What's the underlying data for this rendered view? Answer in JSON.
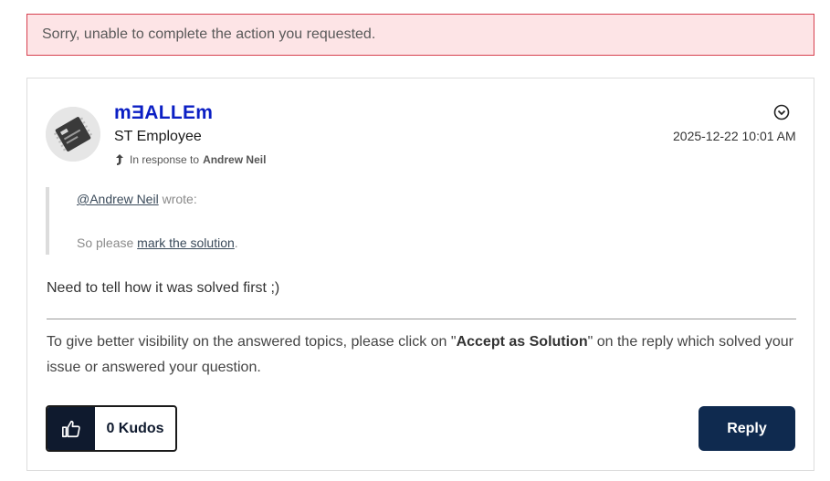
{
  "alert": {
    "message": "Sorry, unable to complete the action you requested."
  },
  "post": {
    "author": "mƎALLEm",
    "rank": "ST Employee",
    "in_response_prefix": "In response to",
    "in_response_to": "Andrew Neil",
    "timestamp": "2025-12-22 10:01 AM",
    "quote": {
      "mention": "@Andrew Neil",
      "wrote": "wrote:",
      "line2_prefix": "So please",
      "link": "mark the solution",
      "line2_suffix": "."
    },
    "body": "Need to tell how it was solved first ;)",
    "signature": {
      "prefix": "To give better visibility on the answered topics, please click on \"",
      "bold": "Accept as Solution",
      "suffix": "\" on the reply which solved your issue or answered your question."
    }
  },
  "actions": {
    "kudos_label": "0 Kudos",
    "reply_label": "Reply"
  },
  "icons": {
    "avatar": "chip-avatar",
    "options": "chevron-down-circle-icon",
    "in_response": "arrow-up-icon",
    "kudos": "thumbs-up-icon"
  },
  "colors": {
    "alert_bg": "#fde4e6",
    "alert_border": "#d6404f",
    "author": "#0b1fc4",
    "reply_bg": "#0f2a4f",
    "kudos_dark": "#0f1a2e"
  }
}
